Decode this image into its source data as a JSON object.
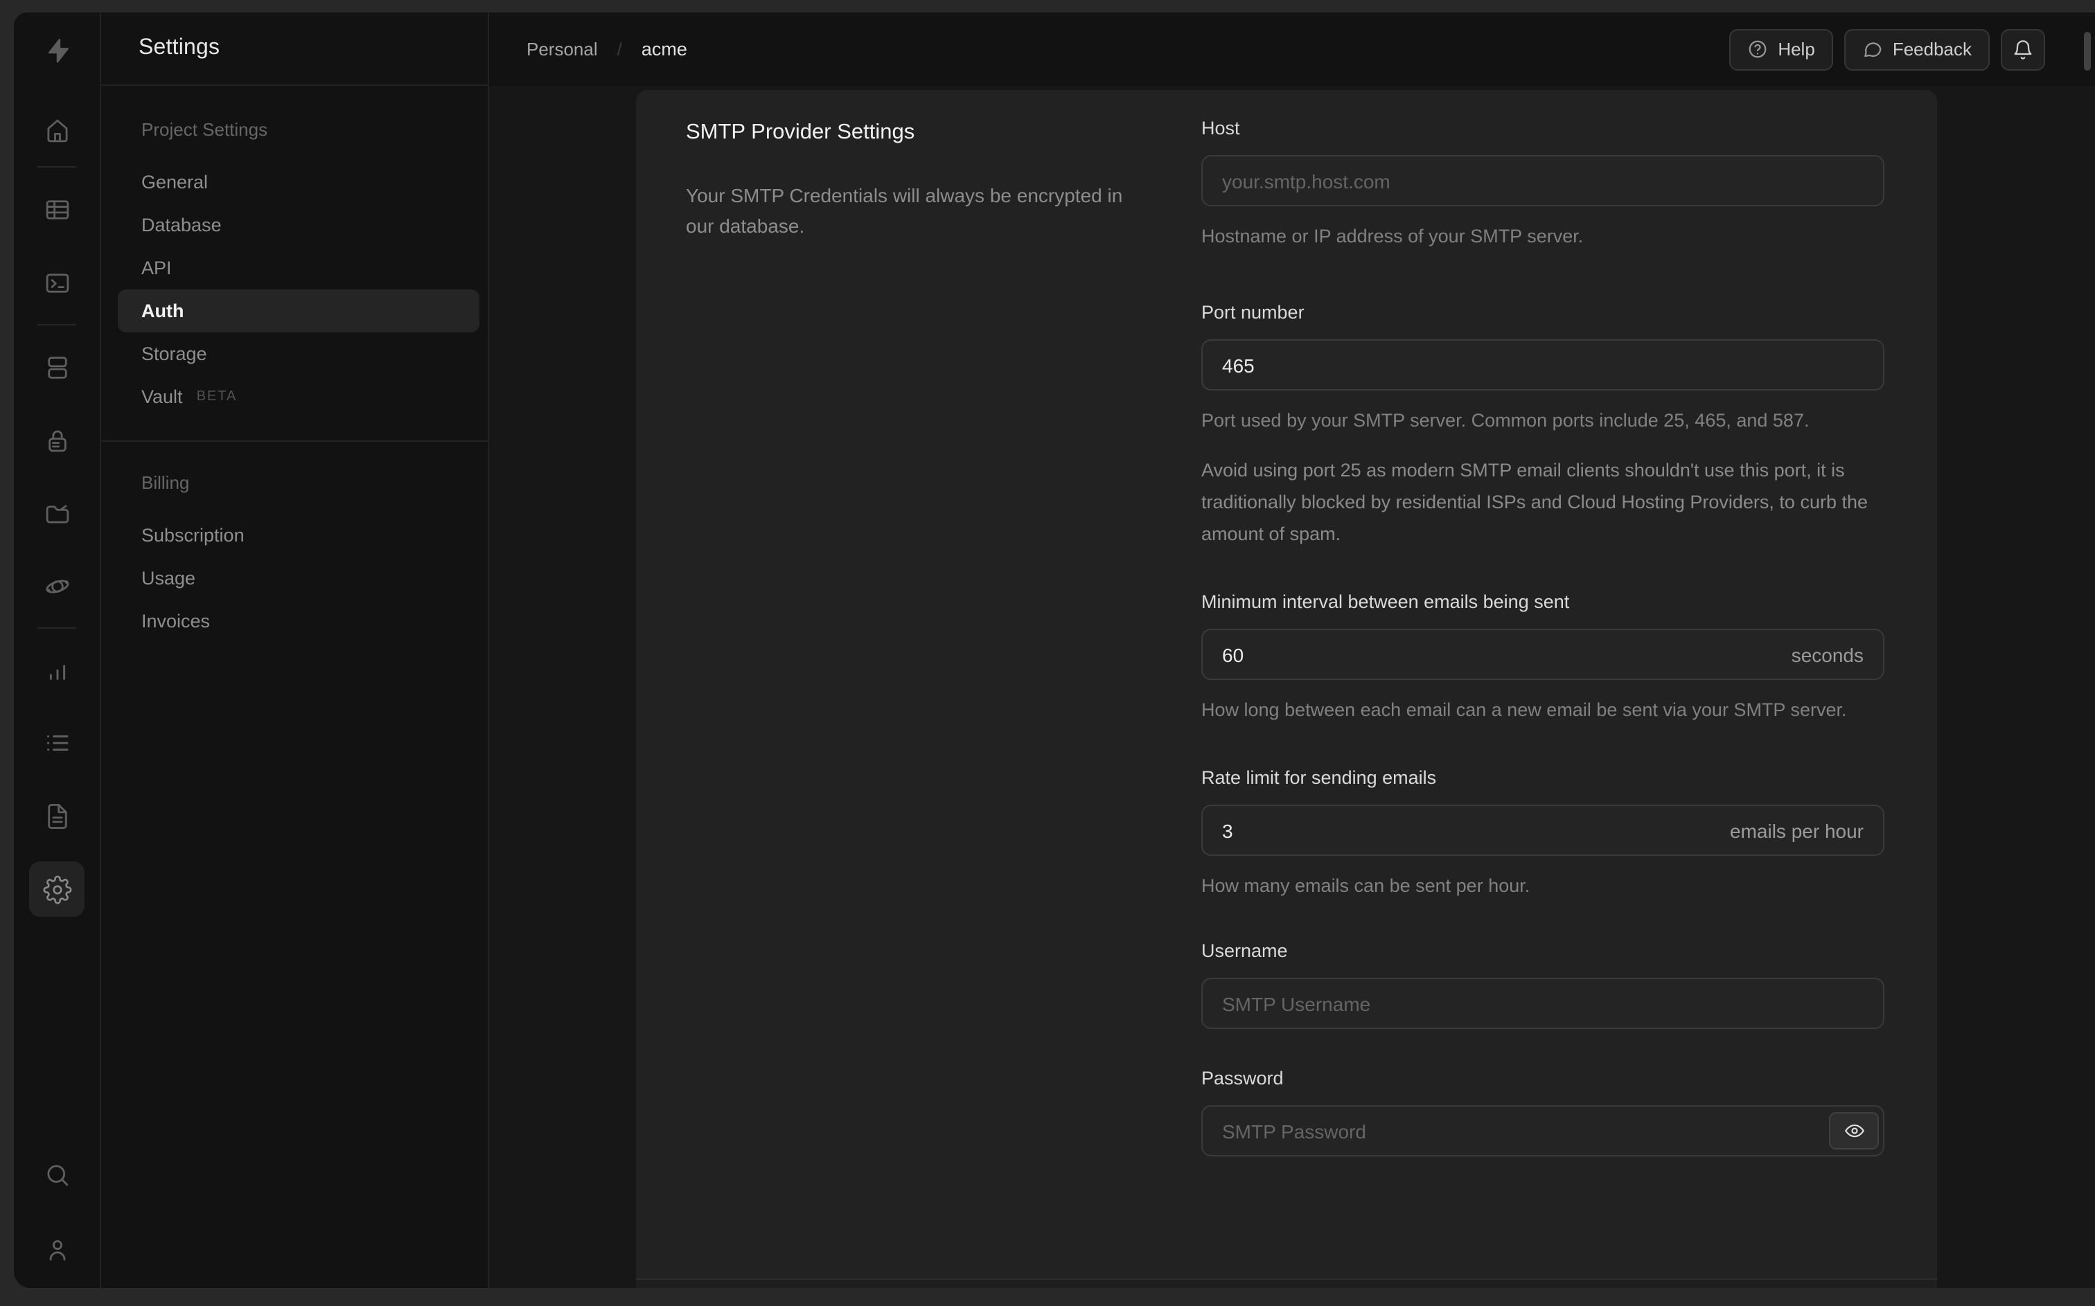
{
  "app": {
    "name": "Supabase",
    "logo_icon": "supabase-bolt-icon"
  },
  "rail": {
    "items": [
      "home-icon",
      "table-editor-icon",
      "sql-editor-icon",
      "database-icon",
      "auth-icon",
      "storage-icon",
      "edge-functions-icon",
      "reports-icon",
      "logs-icon",
      "docs-icon",
      "settings-icon",
      "search-icon",
      "user-icon"
    ],
    "active": "settings-icon"
  },
  "sidebar": {
    "title": "Settings",
    "sections": [
      {
        "label": "Project Settings",
        "items": [
          {
            "label": "General",
            "active": false
          },
          {
            "label": "Database",
            "active": false
          },
          {
            "label": "API",
            "active": false
          },
          {
            "label": "Auth",
            "active": true
          },
          {
            "label": "Storage",
            "active": false
          },
          {
            "label": "Vault",
            "active": false,
            "badge": "BETA"
          }
        ]
      },
      {
        "label": "Billing",
        "items": [
          {
            "label": "Subscription",
            "active": false
          },
          {
            "label": "Usage",
            "active": false
          },
          {
            "label": "Invoices",
            "active": false
          }
        ]
      }
    ]
  },
  "header": {
    "breadcrumb": {
      "org": "Personal",
      "separator": "/",
      "project": "acme"
    },
    "help_label": "Help",
    "feedback_label": "Feedback",
    "bell_icon": "notifications-bell-icon"
  },
  "panel": {
    "title": "SMTP Provider Settings",
    "description": "Your SMTP Credentials will always be encrypted in our database.",
    "form": {
      "host": {
        "label": "Host",
        "placeholder": "your.smtp.host.com",
        "help": "Hostname or IP address of your SMTP server."
      },
      "port": {
        "label": "Port number",
        "value": "465",
        "help": "Port used by your SMTP server. Common ports include 25, 465, and 587.",
        "note": "Avoid using port 25 as modern SMTP email clients shouldn't use this port, it is traditionally blocked by residential ISPs and Cloud Hosting Providers, to curb the amount of spam."
      },
      "interval": {
        "label": "Minimum interval between emails being sent",
        "value": "60",
        "suffix": "seconds",
        "help": "How long between each email can a new email be sent via your SMTP server."
      },
      "rate": {
        "label": "Rate limit for sending emails",
        "value": "3",
        "suffix": "emails per hour",
        "help": "How many emails can be sent per hour."
      },
      "username": {
        "label": "Username",
        "placeholder": "SMTP Username"
      },
      "password": {
        "label": "Password",
        "placeholder": "SMTP Password",
        "toggle_icon": "eye-icon"
      }
    }
  },
  "colors": {
    "window_bg": "#121212",
    "frame_bg": "#282828",
    "content_bg": "#171717",
    "panel_bg": "#222222",
    "border": "#2e2e2e",
    "input_border": "#3a3a3a",
    "text_primary": "#ededed",
    "text_muted": "#8b8b8b",
    "active_row_bg": "#252525"
  }
}
